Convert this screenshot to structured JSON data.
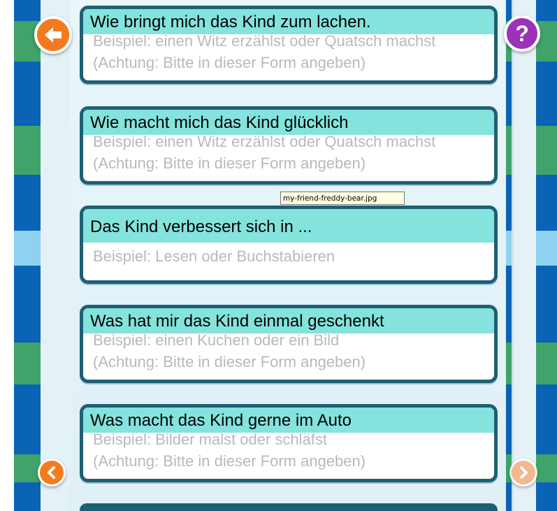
{
  "colors": {
    "stripe_blue": "#0a63b4",
    "stripe_green": "#3fa36a",
    "stripe_light": "#8fd2ef",
    "card_header": "#84e3dd",
    "card_border": "#1f5f74",
    "placeholder_text": "#b9b9b9",
    "back_button": "#f37a1f",
    "help_button": "#9b32b8"
  },
  "nav": {
    "back_icon": "arrow-left-icon",
    "help_icon": "question-mark-icon",
    "help_label": "?",
    "prev_icon": "chevron-left-icon",
    "next_icon": "chevron-right-icon"
  },
  "cards": [
    {
      "title": "Wie bringt mich das Kind zum lachen.",
      "hint1": "Beispiel: einen Witz erzählst oder Quatsch machst",
      "hint2": "(Achtung: Bitte in dieser Form angeben)"
    },
    {
      "title": "Wie macht mich das Kind glücklich",
      "hint1": "Beispiel: einen Witz erzählst oder Quatsch machst",
      "hint2": "(Achtung: Bitte in dieser Form angeben)"
    },
    {
      "title": "Das Kind verbessert sich in ...",
      "hint1": "Beispiel: Lesen oder Buchstabieren"
    },
    {
      "title": "Was hat mir das Kind einmal geschenkt",
      "hint1": "Beispiel: einen Kuchen oder ein Bild",
      "hint2": "(Achtung: Bitte in dieser Form angeben)"
    },
    {
      "title": "Was macht das Kind gerne im Auto",
      "hint1": "Beispiel: Bilder malst oder schläfst",
      "hint2": "(Achtung: Bitte in dieser Form angeben)"
    }
  ],
  "tooltip": {
    "text": "my-friend-freddy-bear.jpg"
  }
}
